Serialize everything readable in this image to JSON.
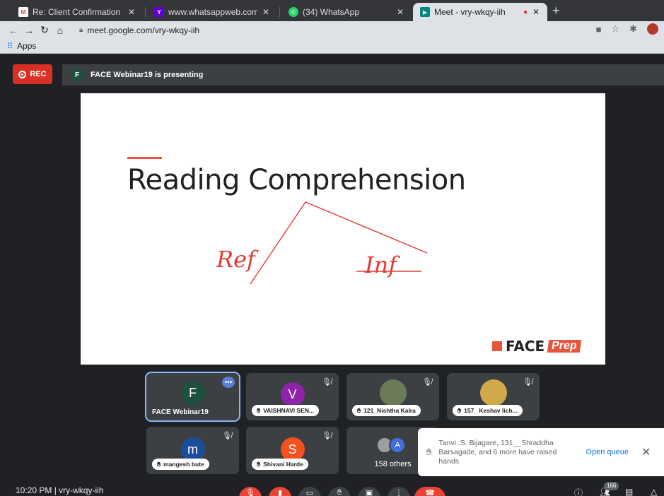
{
  "browser": {
    "tabs": [
      {
        "title": "Re: Client Confirmation M",
        "icon": "gmail-icon",
        "color": "#ea4335"
      },
      {
        "title": "www.whatsappweb.com",
        "icon": "yahoo-icon",
        "color": "#6001d2"
      },
      {
        "title": "(34) WhatsApp",
        "icon": "whatsapp-icon",
        "color": "#25d366"
      },
      {
        "title": "Meet - vry-wkqy-iih",
        "icon": "meet-icon",
        "color": "#00897b",
        "active": true
      }
    ],
    "url": "meet.google.com/vry-wkqy-iih",
    "bookmarks_label": "Apps"
  },
  "meet": {
    "rec_label": "REC",
    "presenter_initial": "F",
    "presenting_text": "FACE Webinar19 is presenting",
    "slide": {
      "title": "Reading Comprehension",
      "annotation_left": "Ref",
      "annotation_right": "Inf",
      "logo_face": "FACE",
      "logo_prep": "Prep"
    },
    "participants": [
      {
        "initial": "F",
        "name": "FACE Webinar19",
        "color": "#1e4f3f"
      },
      {
        "initial": "V",
        "name": "VAISHNAVI SEN...",
        "color": "#8e24aa"
      },
      {
        "initial": "",
        "name": "121_Nishtha Kalra",
        "color": "#6b7b5a"
      },
      {
        "initial": "",
        "name": "157_ Keshav lich...",
        "color": "#cfa94a"
      },
      {
        "initial": "m",
        "name": "mangesh bute",
        "color": "#1a4e9c"
      },
      {
        "initial": "S",
        "name": "Shivani Harde",
        "color": "#f4511e"
      }
    ],
    "others": {
      "initial": "A",
      "label": "158 others"
    },
    "raised_hands": {
      "message": "Tanvi .S. Bijagare, 131__Shraddha Barsagade, and 6 more have raised hands",
      "action": "Open queue"
    },
    "bottom": {
      "time_and_code": "10:20 PM  |  vry-wkqy-iih",
      "participant_count": "166"
    }
  }
}
